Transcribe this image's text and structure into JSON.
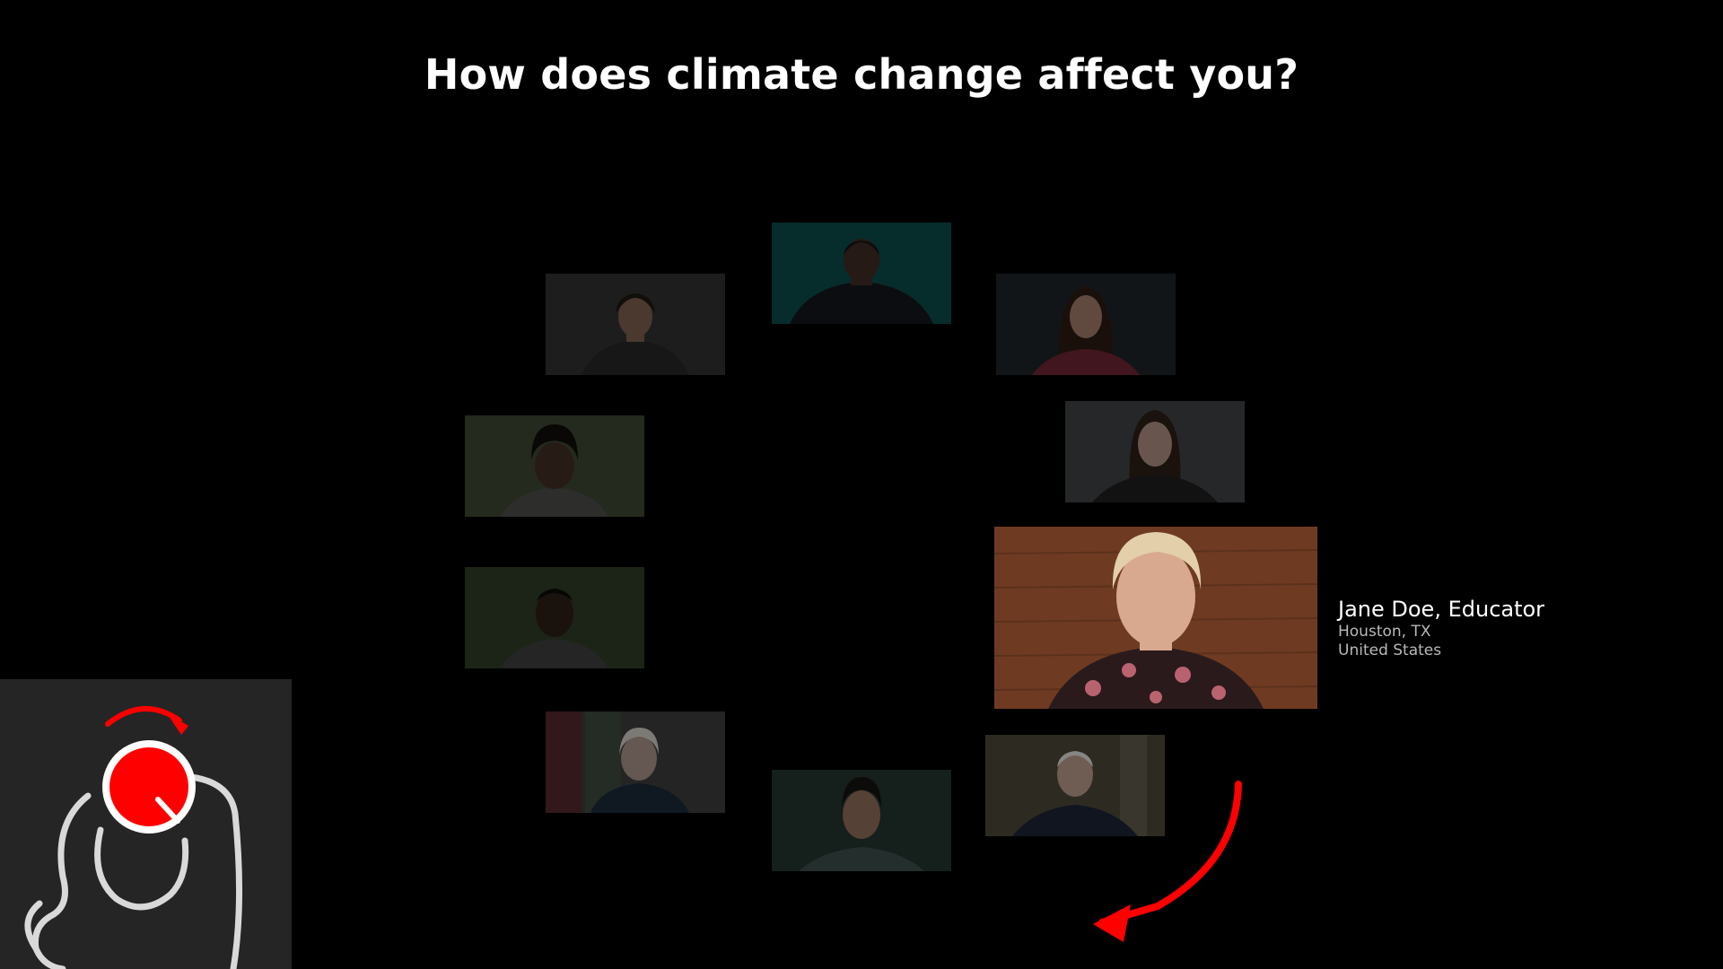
{
  "page": {
    "title": "How does climate change affect you?"
  },
  "tiles": [
    {
      "id": "top-center",
      "bg": "#0c4747",
      "skin": "#3d2a22",
      "hair": "#141414",
      "shirt": "#14161c"
    },
    {
      "id": "top-left",
      "bg": "#303030",
      "skin": "#7a5c4c",
      "hair": "#1d1711",
      "shirt": "#262626"
    },
    {
      "id": "top-right",
      "bg": "#1d2327",
      "skin": "#9b7868",
      "hair": "#2a1a13",
      "shirt": "#6a2431"
    },
    {
      "id": "mid-left-upper",
      "bg": "#3b4430",
      "skin": "#3e2c22",
      "hair": "#0f0d0b",
      "shirt": "#4a4a48"
    },
    {
      "id": "mid-right-upper",
      "bg": "#3e4043",
      "skin": "#a98a7e",
      "hair": "#2b1d16",
      "shirt": "#1e1e20"
    },
    {
      "id": "mid-left-lower",
      "bg": "#2d3a24",
      "skin": "#2b1d15",
      "hair": "#0d0b09",
      "shirt": "#3a3c3a"
    },
    {
      "id": "bottom-left",
      "bg": "#3a3a3a",
      "skin": "#a38d85",
      "hair": "#c9c5bd",
      "shirt": "#1b2838"
    },
    {
      "id": "bottom-center",
      "bg": "#22332c",
      "skin": "#8a6a56",
      "hair": "#141210",
      "shirt": "#3a4b4a"
    },
    {
      "id": "bottom-right",
      "bg": "#4a4438",
      "skin": "#b39586",
      "hair": "#d8d8d4",
      "shirt": "#1a2234"
    }
  ],
  "featured": {
    "name": "Jane Doe, Educator",
    "city": "Houston, TX",
    "country": "United States",
    "bg": "#6e3b22",
    "skin": "#d8a98f",
    "hair": "#e3cfa9",
    "shirt": "#2a1a1c"
  },
  "colors": {
    "accent": "#ff0000",
    "panel": "#252525",
    "hand_outline": "#d9d9d9"
  },
  "icons": {
    "control": "rotary-dial-hand-icon",
    "arrow": "curved-arrow-icon"
  }
}
